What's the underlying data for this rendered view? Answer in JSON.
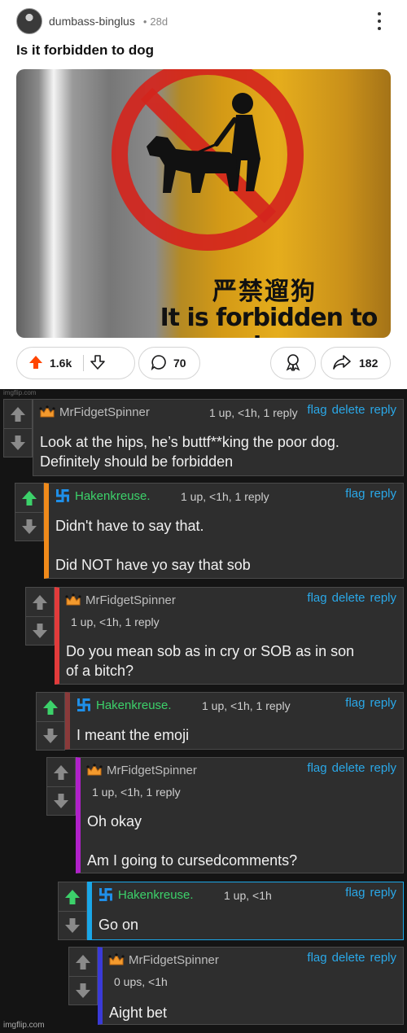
{
  "post": {
    "username": "dumbass-binglus",
    "dot": "•",
    "age": "28d",
    "title": "Is it forbidden to dog",
    "image": {
      "sign_cn": "严禁遛狗",
      "sign_en": "It is forbidden to dog",
      "accent_colors": {
        "prohibition_red": "#d4251d",
        "metal_gold": "#e0a51b"
      }
    },
    "actions": {
      "upvotes": "1.6k",
      "comments": "70",
      "shares": "182"
    },
    "colors": {
      "upvote_active": "#ff4500"
    }
  },
  "watermark_top": "imgflip.com",
  "watermark_bottom": "imgflip.com",
  "thread": {
    "link_color": "#2aa8e8",
    "comments": [
      {
        "author": "MrFidgetSpinner",
        "author_icon": "crown-icon",
        "author_color": "#bdbdbd",
        "meta": "1 up, <1h, 1 reply",
        "links": [
          "flag",
          "delete",
          "reply"
        ],
        "upvoted": false,
        "stripe_color": "#4a4a4a",
        "text": [
          "Look at the hips, he’s buttf**king the poor dog.",
          "Definitely should be forbidden"
        ]
      },
      {
        "author": "Hakenkreuse.",
        "author_icon": "hooked-cross-icon",
        "author_color": "#3cd16a",
        "meta": "1 up, <1h, 1 reply",
        "links": [
          "flag",
          "reply"
        ],
        "upvoted": true,
        "stripe_color": "#f08a1a",
        "text": [
          "Didn't have to say that.",
          "",
          "Did NOT have yo say that sob"
        ]
      },
      {
        "author": "MrFidgetSpinner",
        "author_icon": "crown-icon",
        "author_color": "#bdbdbd",
        "meta": "1 up, <1h, 1 reply",
        "links": [
          "flag",
          "delete",
          "reply"
        ],
        "upvoted": false,
        "stripe_color": "#e23b3b",
        "text": [
          "Do you mean sob as in cry or SOB as in son",
          "of a bitch?"
        ]
      },
      {
        "author": "Hakenkreuse.",
        "author_icon": "hooked-cross-icon",
        "author_color": "#3cd16a",
        "meta": "1 up, <1h, 1 reply",
        "links": [
          "flag",
          "reply"
        ],
        "upvoted": true,
        "stripe_color": "#8a3a3a",
        "text": [
          "I meant the emoji"
        ]
      },
      {
        "author": "MrFidgetSpinner",
        "author_icon": "crown-icon",
        "author_color": "#bdbdbd",
        "meta": "1 up, <1h, 1 reply",
        "links": [
          "flag",
          "delete",
          "reply"
        ],
        "upvoted": false,
        "stripe_color": "#b021c9",
        "text": [
          "Oh okay",
          "",
          "Am I going to cursedcomments?"
        ]
      },
      {
        "author": "Hakenkreuse.",
        "author_icon": "hooked-cross-icon",
        "author_color": "#3cd16a",
        "meta": "1 up, <1h",
        "links": [
          "flag",
          "reply"
        ],
        "upvoted": true,
        "stripe_color": "#1aa7e8",
        "text": [
          "Go on"
        ]
      },
      {
        "author": "MrFidgetSpinner",
        "author_icon": "crown-icon",
        "author_color": "#bdbdbd",
        "meta": "0 ups, <1h",
        "links": [
          "flag",
          "delete",
          "reply"
        ],
        "upvoted": false,
        "stripe_color": "#3a3ad8",
        "text": [
          "Aight bet"
        ]
      }
    ]
  }
}
